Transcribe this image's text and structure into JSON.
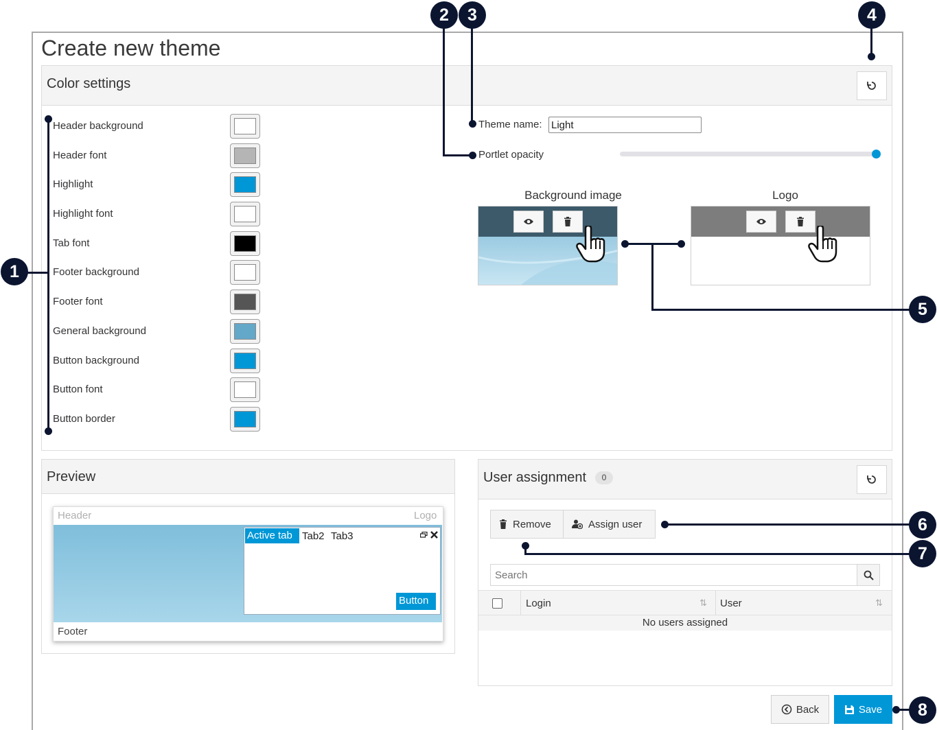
{
  "page": {
    "title": "Create new theme"
  },
  "color_settings": {
    "title": "Color settings",
    "items": [
      {
        "label": "Header background",
        "color": "#ffffff"
      },
      {
        "label": "Header font",
        "color": "#b5b5b5"
      },
      {
        "label": "Highlight",
        "color": "#0097d7"
      },
      {
        "label": "Highlight font",
        "color": "#ffffff"
      },
      {
        "label": "Tab font",
        "color": "#000000"
      },
      {
        "label": "Footer background",
        "color": "#ffffff"
      },
      {
        "label": "Footer font",
        "color": "#555555"
      },
      {
        "label": "General background",
        "color": "#63a8c9"
      },
      {
        "label": "Button background",
        "color": "#0097d7"
      },
      {
        "label": "Button font",
        "color": "#ffffff"
      },
      {
        "label": "Button border",
        "color": "#0097d7"
      }
    ],
    "theme_name_label": "Theme name:",
    "theme_name_value": "Light",
    "opacity_label": "Portlet opacity",
    "opacity_value": 1.0,
    "background_image_title": "Background image",
    "logo_title": "Logo"
  },
  "preview": {
    "title": "Preview",
    "header_text": "Header",
    "logo_text": "Logo",
    "tabs": [
      "Active tab",
      "Tab2",
      "Tab3"
    ],
    "button_text": "Button",
    "footer_text": "Footer"
  },
  "user_assignment": {
    "title": "User assignment",
    "count": "0",
    "remove_label": "Remove",
    "assign_label": "Assign user",
    "search_placeholder": "Search",
    "columns": [
      "Login",
      "User"
    ],
    "empty_text": "No users assigned"
  },
  "footer": {
    "back_label": "Back",
    "save_label": "Save"
  },
  "callouts": [
    "1",
    "2",
    "3",
    "4",
    "5",
    "6",
    "7",
    "8"
  ],
  "colors": {
    "accent": "#0097d7",
    "callout": "#0b1530"
  }
}
